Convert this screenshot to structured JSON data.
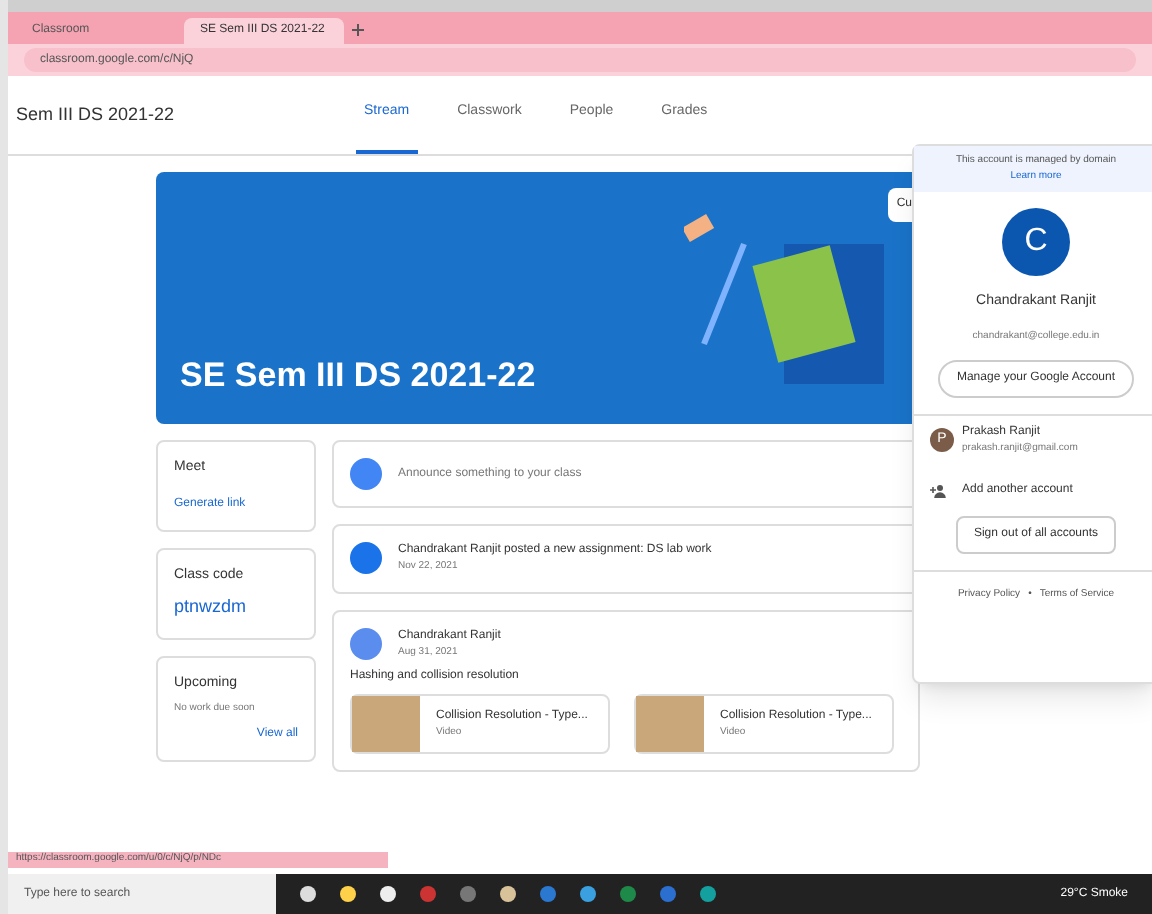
{
  "browser": {
    "tabs": [
      {
        "title": "Classroom",
        "selected": false
      },
      {
        "title": "SE Sem III DS 2021-22",
        "selected": true
      }
    ],
    "address": "classroom.google.com/c/NjQ"
  },
  "header": {
    "class_name": "Sem III DS 2021-22",
    "tabs": [
      {
        "label": "Stream",
        "selected": true
      },
      {
        "label": "Classwork",
        "selected": false
      },
      {
        "label": "People",
        "selected": false
      },
      {
        "label": "Grades",
        "selected": false
      }
    ]
  },
  "banner": {
    "title": "SE Sem III DS 2021-22",
    "button": "Cu"
  },
  "meet": {
    "label": "Meet",
    "link": "Generate link"
  },
  "class_code": {
    "label": "Class code",
    "code": "ptnwzdm"
  },
  "upcoming": {
    "label": "Upcoming",
    "text": "No work due soon",
    "link": "View all"
  },
  "announce": {
    "placeholder": "Announce something to your class"
  },
  "posts": [
    {
      "kind": "assignment",
      "title": "Chandrakant Ranjit posted a new assignment: DS lab work",
      "date": "Nov 22, 2021"
    },
    {
      "kind": "material",
      "title": "Chandrakant Ranjit",
      "date": "Aug 31, 2021",
      "body": "Hashing and collision resolution",
      "attachments": [
        {
          "title": "Collision Resolution - Type...",
          "sub": "Video"
        },
        {
          "title": "Collision Resolution - Type...",
          "sub": "Video"
        }
      ]
    }
  ],
  "account": {
    "notice": "This account is managed by domain",
    "learn": "Learn more",
    "initial": "C",
    "name": "Chandrakant Ranjit",
    "email": "chandrakant@college.edu.in",
    "manage": "Manage your Google Account",
    "other": {
      "initial": "P",
      "name": "Prakash Ranjit",
      "email": "prakash.ranjit@gmail.com"
    },
    "add": "Add another account",
    "signout": "Sign out of all accounts",
    "privacy": "Privacy Policy",
    "sep": "•",
    "terms": "Terms of Service"
  },
  "status_url": "https://classroom.google.com/u/0/c/NjQ/p/NDc",
  "taskbar": {
    "search": "Type here to search",
    "weather": "29°C Smoke"
  }
}
